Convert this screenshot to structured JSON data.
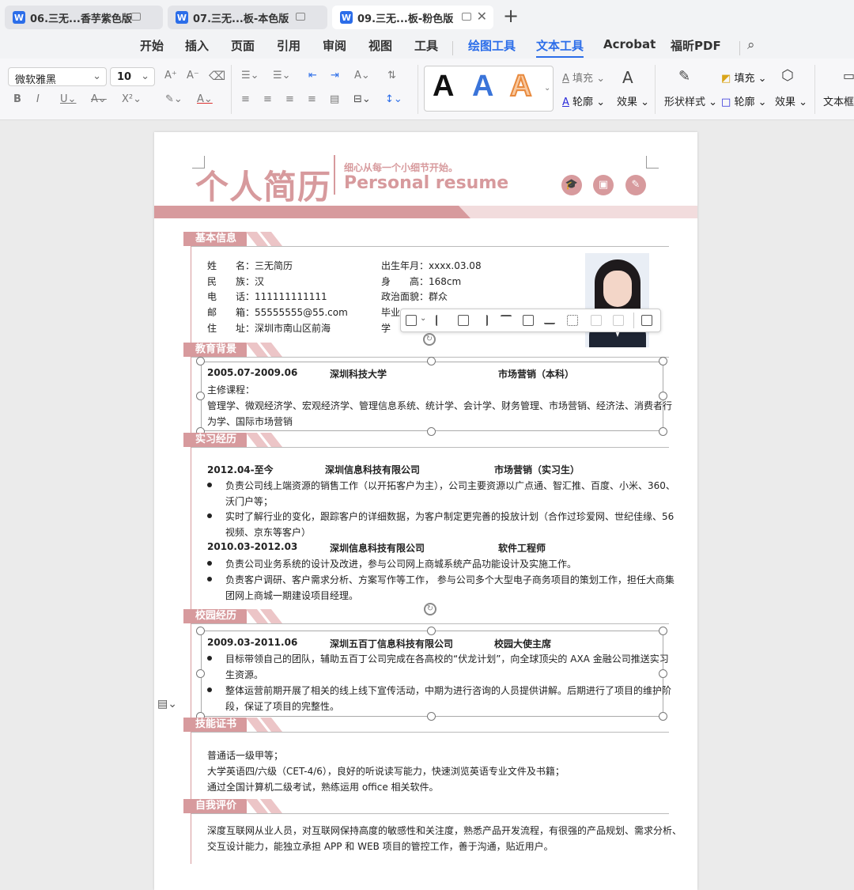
{
  "tabs": [
    {
      "label": "06.三无...香芋紫色版",
      "icon": "word-icon"
    },
    {
      "label": "07.三无...板-本色版",
      "icon": "word-icon"
    },
    {
      "label": "09.三无...板-粉色版",
      "icon": "word-icon"
    }
  ],
  "menu": [
    "开始",
    "插入",
    "页面",
    "引用",
    "审阅",
    "视图",
    "工具",
    "绘图工具",
    "文本工具",
    "Acrobat",
    "福昕PDF"
  ],
  "toolbar": {
    "font_name": "微软雅黑",
    "font_size": "10",
    "fill_label": "填充",
    "outline_label": "轮廓",
    "effect_label": "效果",
    "shape_style_label": "形状样式",
    "fill2_label": "填充",
    "outline2_label": "轮廓",
    "effect2_label": "效果",
    "textbox_label": "文本框"
  },
  "colors": {
    "accent": "#d79a9d",
    "accent_light": "#f2dcdd",
    "tab_blue": "#2b6de9"
  },
  "resume": {
    "title_cn": "个人简历",
    "tagline": "细心从每一个小细节开始。",
    "title_en": "Personal resume",
    "header_icons": [
      "graduation-cap-icon",
      "briefcase-icon",
      "pen-icon"
    ],
    "sections": {
      "basic": "基本信息",
      "education": "教育背景",
      "internship": "实习经历",
      "campus": "校园经历",
      "skills": "技能证书",
      "self": "自我评价"
    },
    "basic": {
      "left": [
        [
          "姓　　名：",
          "三无简历"
        ],
        [
          "民　　族：",
          "汉"
        ],
        [
          "电　　话：",
          "111111111111"
        ],
        [
          "邮　　箱：",
          "55555555@55.com"
        ],
        [
          "住　　址：",
          "深圳市南山区前海"
        ]
      ],
      "right": [
        [
          "出生年月：",
          "xxxx.03.08"
        ],
        [
          "身　　高：",
          "168cm"
        ],
        [
          "政治面貌：",
          "群众"
        ],
        [
          "毕业院校：",
          ""
        ],
        [
          "学　　历：",
          ""
        ]
      ],
      "right_visible": [
        "出生年月：xxxx.03.08",
        "身　　高：168cm",
        "政治面貌：群众",
        "毕业",
        "学"
      ]
    },
    "education": {
      "date": "2005.07-2009.06",
      "school": "深圳科技大学",
      "major": "市场营销（本科）",
      "course_label": "主修课程：",
      "courses_1": "管理学、微观经济学、宏观经济学、管理信息系统、统计学、会计学、财务管理、市场营销、经济法、消费者行",
      "courses_2": "为学、国际市场营销"
    },
    "internship": [
      {
        "date": "2012.04-至今",
        "company": "深圳信息科技有限公司",
        "role": "市场营销（实习生）",
        "bullets": [
          [
            "负责公司线上端资源的销售工作（以开拓客户为主），公司主要资源以广点通、智汇推、百度、小米、360、",
            "沃门户等；"
          ],
          [
            "实时了解行业的变化，跟踪客户的详细数据，为客户制定更完善的投放计划（合作过珍爱网、世纪佳缘、56",
            "视频、京东等客户）"
          ]
        ]
      },
      {
        "date": "2010.03-2012.03",
        "company": "深圳信息科技有限公司",
        "role": "软件工程师",
        "bullets": [
          [
            "负责公司业务系统的设计及改进，参与公司网上商城系统产品功能设计及实施工作。",
            ""
          ],
          [
            "负责客户调研、客户需求分析、方案写作等工作，  参与公司多个大型电子商务项目的策划工作，担任大商集",
            "团网上商城一期建设项目经理。"
          ]
        ]
      }
    ],
    "campus": {
      "date": "2009.03-2011.06",
      "company": "深圳五百丁信息科技有限公司",
      "role": "校园大使主席",
      "bullets": [
        [
          "目标带领自己的团队，辅助五百丁公司完成在各高校的“伏龙计划”，向全球顶尖的 AXA 金融公司推送实习",
          "生资源。"
        ],
        [
          "整体运营前期开展了相关的线上线下宣传活动，中期为进行咨询的人员提供讲解。后期进行了项目的维护阶",
          "段，保证了项目的完整性。"
        ]
      ]
    },
    "skills": [
      "普通话一级甲等；",
      "大学英语四/六级（CET-4/6），良好的听说读写能力，快速浏览英语专业文件及书籍；",
      "通过全国计算机二级考试，熟练运用 office 相关软件。"
    ],
    "self": [
      "深度互联网从业人员，对互联网保持高度的敏感性和关注度，熟悉产品开发流程，有很强的产品规划、需求分析、",
      "交互设计能力，能独立承担 APP 和 WEB 项目的管控工作，善于沟通，贴近用户。"
    ]
  }
}
